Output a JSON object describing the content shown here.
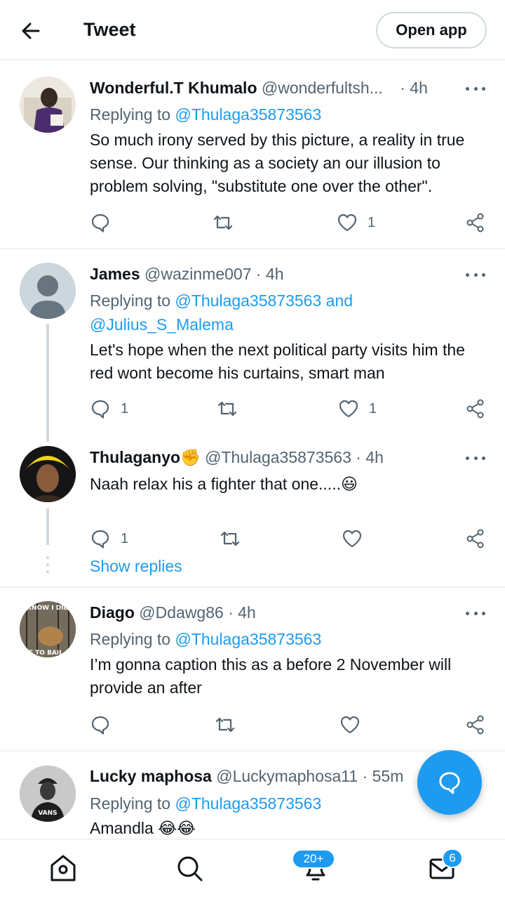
{
  "header": {
    "title": "Tweet",
    "open_app_label": "Open app"
  },
  "tweets": [
    {
      "name": "Wonderful.T Khumalo",
      "handle": "@wonderfultsh...",
      "time": "· 4h",
      "reply_prefix": "Replying to ",
      "reply_to": "@Thulaga35873563",
      "text": "So much irony served by this picture, a reality in true sense. Our thinking as a society an our illusion to problem solving, \"substitute one over the other\".",
      "reply_count": "",
      "retweet_count": "",
      "like_count": "1"
    },
    {
      "name": "James",
      "handle": "@wazinme007",
      "time": "· 4h",
      "reply_prefix": "Replying to ",
      "reply_to": "@Thulaga35873563 and",
      "reply_to_2": "@Julius_S_Malema",
      "text": "Let's hope when the  next political party  visits him the red wont become  his curtains, smart man",
      "reply_count": "1",
      "retweet_count": "",
      "like_count": "1"
    },
    {
      "name": "Thulaganyo",
      "name_emoji": "✊",
      "handle": "@Thulaga35873563",
      "time": "· 4h",
      "text": "Naah relax his a fighter that one.....",
      "text_emoji": "😃",
      "reply_count": "1",
      "retweet_count": "",
      "like_count": ""
    },
    {
      "name": "Diago",
      "handle": "@Ddawg86",
      "time": "· 4h",
      "reply_prefix": "Replying to ",
      "reply_to": "@Thulaga35873563",
      "text": "I’m gonna caption this as a before 2 November will provide an after",
      "reply_count": "",
      "retweet_count": "",
      "like_count": ""
    },
    {
      "name": "Lucky maphosa",
      "handle": "@Luckymaphosa11",
      "time": "· 55m",
      "reply_prefix": "Replying to ",
      "reply_to": "@Thulaga35873563",
      "text": "Amandla ",
      "text_emoji": "😂😂"
    }
  ],
  "show_replies_label": "Show replies",
  "avatars": {
    "diago_top_text": "KNOW I DID",
    "diago_bottom_text": "VE TO BAIL M",
    "lucky_cap_text": "VANS"
  },
  "bottom_nav": {
    "notifications_badge": "20+",
    "messages_badge": "6"
  },
  "colors": {
    "accent": "#1d9bf0",
    "text": "#0f1419",
    "muted": "#536471",
    "border": "#eff3f4"
  }
}
